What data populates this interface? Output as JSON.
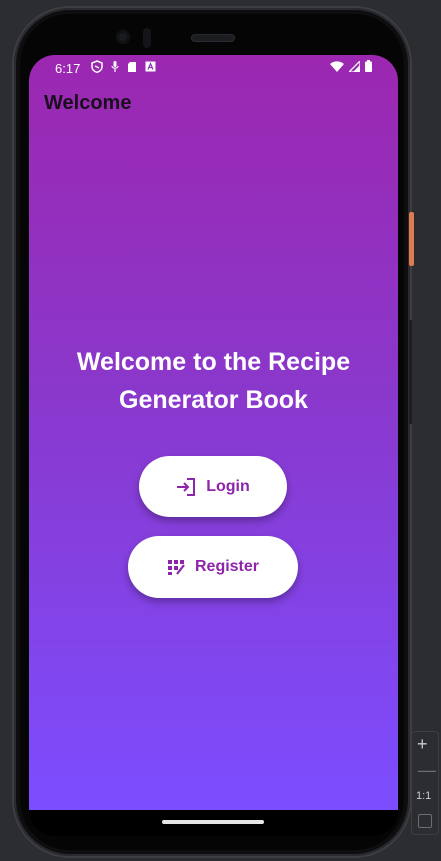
{
  "status_bar": {
    "time": "6:17",
    "left_icons": [
      "shield-icon",
      "microphone-icon",
      "sd-card-icon",
      "a-box-icon"
    ],
    "right_icons": [
      "wifi-icon",
      "signal-icon",
      "battery-icon"
    ]
  },
  "app_bar": {
    "title": "Welcome"
  },
  "main": {
    "headline": "Welcome to the Recipe Generator Book",
    "buttons": {
      "login_label": "Login",
      "register_label": "Register"
    }
  },
  "zoom_controls": {
    "plus": "+",
    "minus": "—",
    "ratio": "1:1"
  },
  "colors": {
    "gradient_top": "#9c27b0",
    "gradient_bottom": "#7c4dff",
    "button_text": "#8e24aa",
    "button_bg": "#ffffff",
    "side_button": "#e07a52"
  }
}
